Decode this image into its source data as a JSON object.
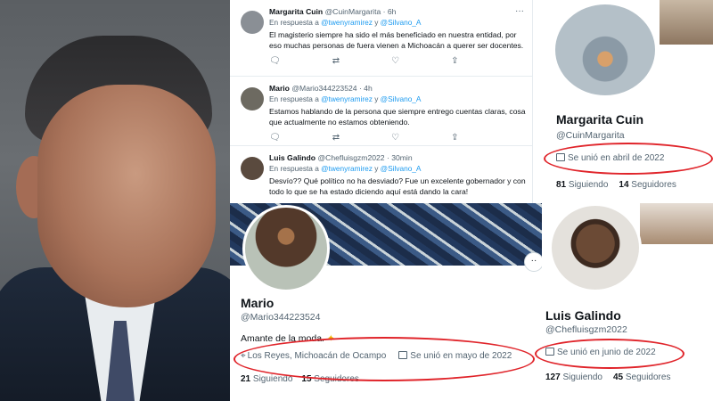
{
  "tweets": [
    {
      "name": "Margarita Cuin",
      "handle": "@CuinMargarita",
      "time": "· 6h",
      "reply_prefix": "En respuesta a",
      "mention1": "@twenyramirez",
      "reply_and": "y",
      "mention2": "@Silvano_A",
      "text": "El magisterio siempre ha sido el más beneficiado en nuestra entidad, por eso muchas personas de fuera vienen a Michoacán a querer ser docentes.",
      "actions": [
        "reply-icon",
        "retweet-icon",
        "like-icon",
        "share-icon"
      ]
    },
    {
      "name": "Mario",
      "handle": "@Mario344223524",
      "time": "· 4h",
      "reply_prefix": "En respuesta a",
      "mention1": "@twenyramirez",
      "reply_and": "y",
      "mention2": "@Silvano_A",
      "text": "Estamos hablando de la persona que siempre entrego cuentas claras, cosa que actualmente no estamos obteniendo.",
      "actions": [
        "reply-icon",
        "retweet-icon",
        "like-icon",
        "share-icon"
      ]
    },
    {
      "name": "Luis Galindo",
      "handle": "@Chefluisgzm2022",
      "time": "· 30min",
      "reply_prefix": "En respuesta a",
      "mention1": "@twenyramirez",
      "reply_and": "y",
      "mention2": "@Silvano_A",
      "text": "Desvío?? Qué político no ha desviado? Fue un excelente gobernador y con todo lo que se ha estado diciendo aquí está dando la cara!"
    }
  ],
  "profiles": {
    "mario": {
      "name": "Mario",
      "handle": "@Mario344223524",
      "bio": "Amante de la moda.",
      "location": "Los Reyes, Michoacán de Ocampo",
      "joined": "Se unió en mayo de 2022",
      "following_count": "21",
      "following_label": "Siguiendo",
      "followers_count": "15",
      "followers_label": "Seguidores"
    },
    "margarita": {
      "name": "Margarita Cuin",
      "handle": "@CuinMargarita",
      "joined": "Se unió en abril de 2022",
      "following_count": "81",
      "following_label": "Siguiendo",
      "followers_count": "14",
      "followers_label": "Seguidores"
    },
    "luis": {
      "name": "Luis Galindo",
      "handle": "@Chefluisgzm2022",
      "joined": "Se unió en junio de 2022",
      "following_count": "127",
      "following_label": "Siguiendo",
      "followers_count": "45",
      "followers_label": "Seguidores"
    }
  },
  "colors": {
    "highlight": "#e0242a",
    "link": "#1d9bf0",
    "muted": "#536471",
    "text": "#0f1419"
  }
}
